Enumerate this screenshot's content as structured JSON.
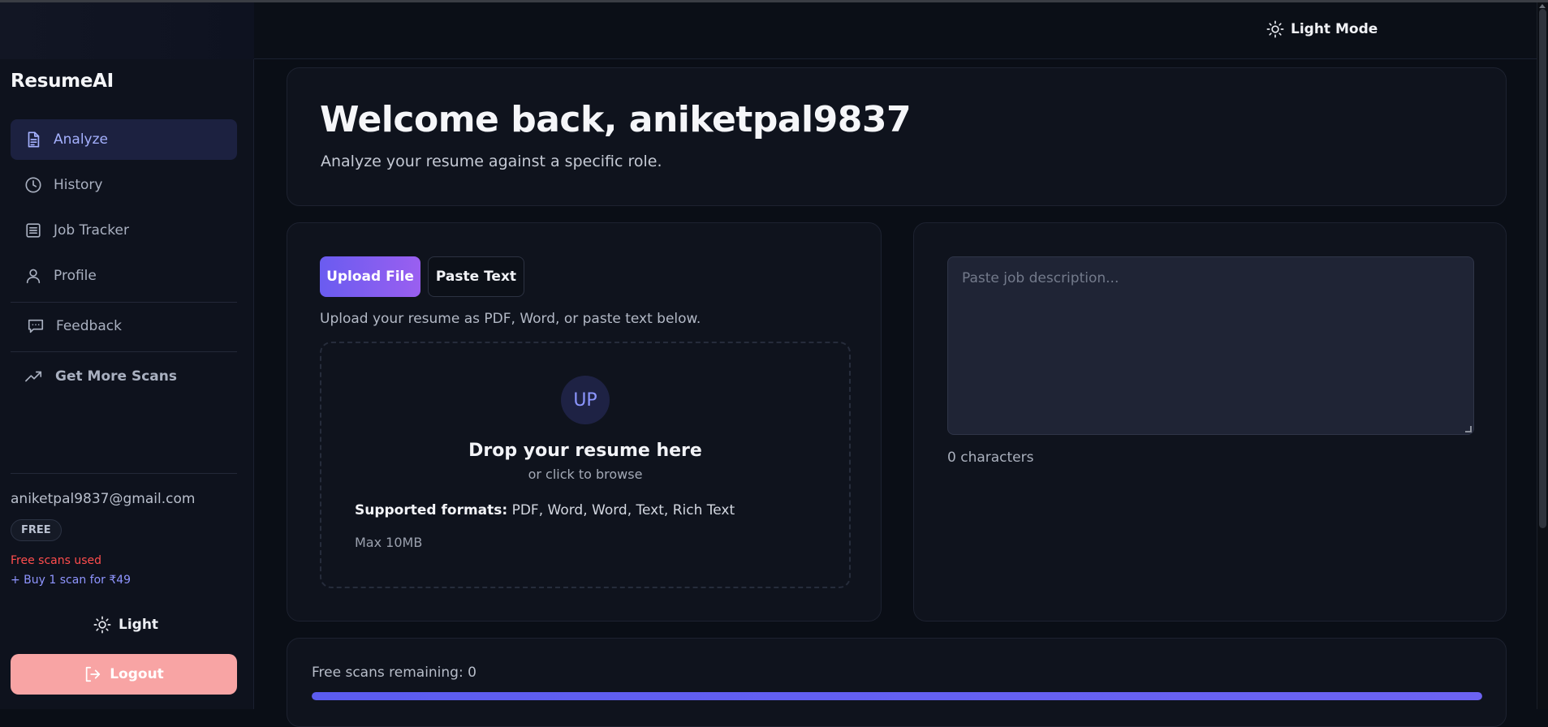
{
  "header": {
    "mode_toggle_label": "Light Mode"
  },
  "sidebar": {
    "brand": "ResumeAI",
    "items": [
      {
        "label": "Analyze",
        "icon": "document-icon",
        "active": true
      },
      {
        "label": "History",
        "icon": "clock-icon"
      },
      {
        "label": "Job Tracker",
        "icon": "list-icon"
      },
      {
        "label": "Profile",
        "icon": "user-icon"
      },
      {
        "label": "Feedback",
        "icon": "chat-icon"
      },
      {
        "label": "Get More Scans",
        "icon": "trending-up-icon"
      }
    ],
    "user_email": "aniketpal9837@gmail.com",
    "plan_badge": "FREE",
    "scans_status": "Free scans used",
    "buy_link": "+ Buy 1 scan for ₹49",
    "theme_toggle_label": "Light",
    "logout_label": "Logout"
  },
  "welcome": {
    "title": "Welcome back, aniketpal9837",
    "subtitle": "Analyze your resume against a specific role."
  },
  "upload": {
    "tabs": [
      "Upload File",
      "Paste Text"
    ],
    "active_tab": "Upload File",
    "hint": "Upload your resume as PDF, Word, or paste text below.",
    "icon_text": "UP",
    "drop_title": "Drop your resume here",
    "drop_subtitle": "or click to browse",
    "formats_label": "Supported formats:",
    "formats_value": " PDF, Word, Word, Text, Rich Text",
    "max_size": "Max 10MB"
  },
  "job_description": {
    "placeholder": "Paste job description...",
    "value": "",
    "char_count": "0 characters"
  },
  "scans": {
    "remaining_label": "Free scans remaining: 0",
    "progress_fraction": 1.0
  },
  "colors": {
    "accent": "#6a5cf0",
    "danger": "#ff4d4d",
    "logout_bg": "#f8a4a4",
    "link": "#8f95ff"
  }
}
